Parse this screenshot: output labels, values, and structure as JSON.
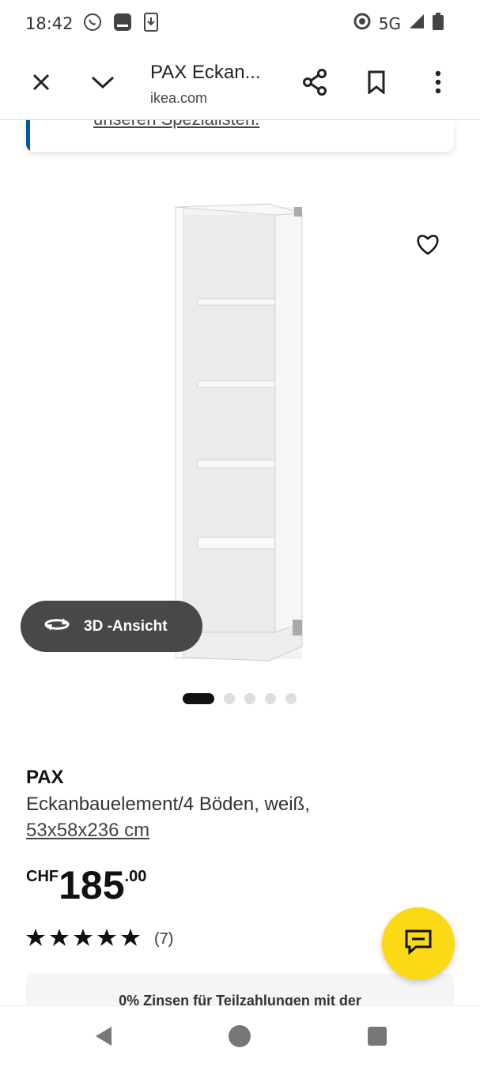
{
  "status_bar": {
    "time": "18:42",
    "network": "5G",
    "icons": [
      "whatsapp-icon",
      "app-icon",
      "download-icon",
      "data-saver-icon",
      "signal-icon",
      "battery-icon"
    ]
  },
  "browser": {
    "page_title": "PAX Eckan...",
    "domain": "ikea.com",
    "icons": [
      "close-icon",
      "chevron-down-icon",
      "share-icon",
      "bookmark-icon",
      "more-vert-icon"
    ]
  },
  "info_card": {
    "link_text": "unseren Spezialisten."
  },
  "gallery": {
    "view_3d_label": "3D -Ansicht",
    "image_count": 5,
    "active_index": 0
  },
  "product": {
    "name": "PAX",
    "description": "Eckanbauelement/4 Böden, weiß,",
    "size": "53x58x236 cm",
    "price_currency": "CHF",
    "price_integer": "185",
    "price_decimal": ".00",
    "rating_value": 5,
    "review_count": "(7)"
  },
  "promo": {
    "text": "0% Zinsen für Teilzahlungen mit der"
  },
  "colors": {
    "accent_blue": "#0058a3",
    "chat_yellow": "#fbd914",
    "pill_gray": "#484848"
  }
}
